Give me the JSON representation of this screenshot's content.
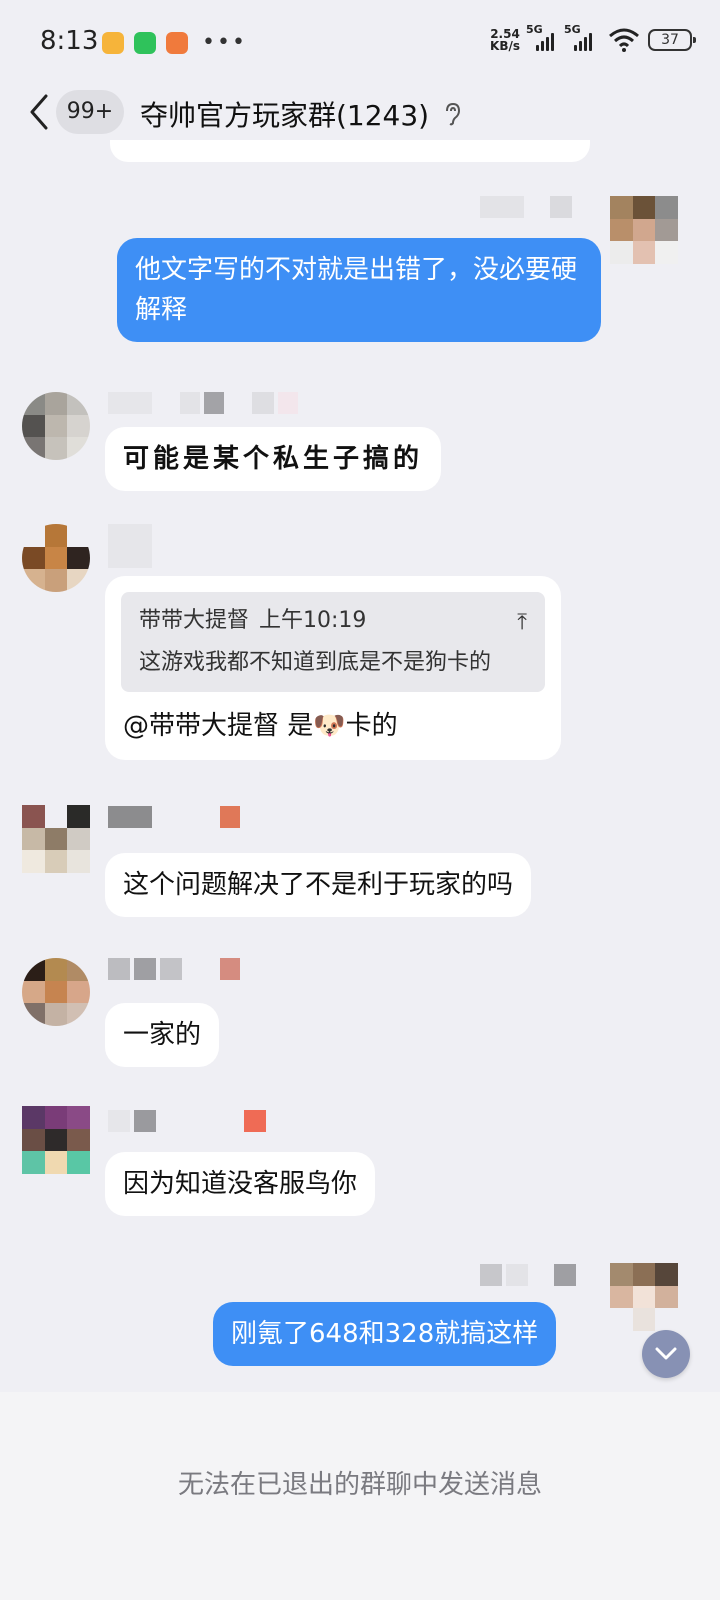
{
  "status_bar": {
    "time": "8:13",
    "net_speed_value": "2.54",
    "net_speed_unit": "KB/s",
    "sim1_label": "5G",
    "sim2_label": "5G",
    "battery": "37",
    "notification_icons": [
      "message-icon",
      "wechat-icon",
      "app-icon"
    ],
    "more": "•••"
  },
  "header": {
    "unread_badge": "99+",
    "title": "夺帅官方玩家群(1243)",
    "back_icon": "back-arrow-icon",
    "ear_icon": "ear-icon"
  },
  "messages": [
    {
      "side": "out",
      "text": "他文字写的不对就是出错了，没必要硬解释"
    },
    {
      "side": "in",
      "text": "可能是某个私生子搞的"
    },
    {
      "side": "in",
      "quote_author": "带带大提督",
      "quote_time": "上午10:19",
      "quote_text": "这游戏我都不知道到底是不是狗卡的",
      "mention": "@带带大提督",
      "text_before_emoji": " 是",
      "emoji": "🐶",
      "text_after_emoji": "卡的"
    },
    {
      "side": "in",
      "text": "这个问题解决了不是利于玩家的吗"
    },
    {
      "side": "in",
      "text": "一家的"
    },
    {
      "side": "in",
      "text": "因为知道没客服鸟你"
    },
    {
      "side": "out",
      "text": "刚氪了648和328就搞这样"
    }
  ],
  "footer": {
    "notice": "无法在已退出的群聊中发送消息"
  },
  "colors": {
    "outgoing_bubble": "#3e8ff5",
    "incoming_bubble": "#ffffff",
    "background": "#efeff4"
  }
}
